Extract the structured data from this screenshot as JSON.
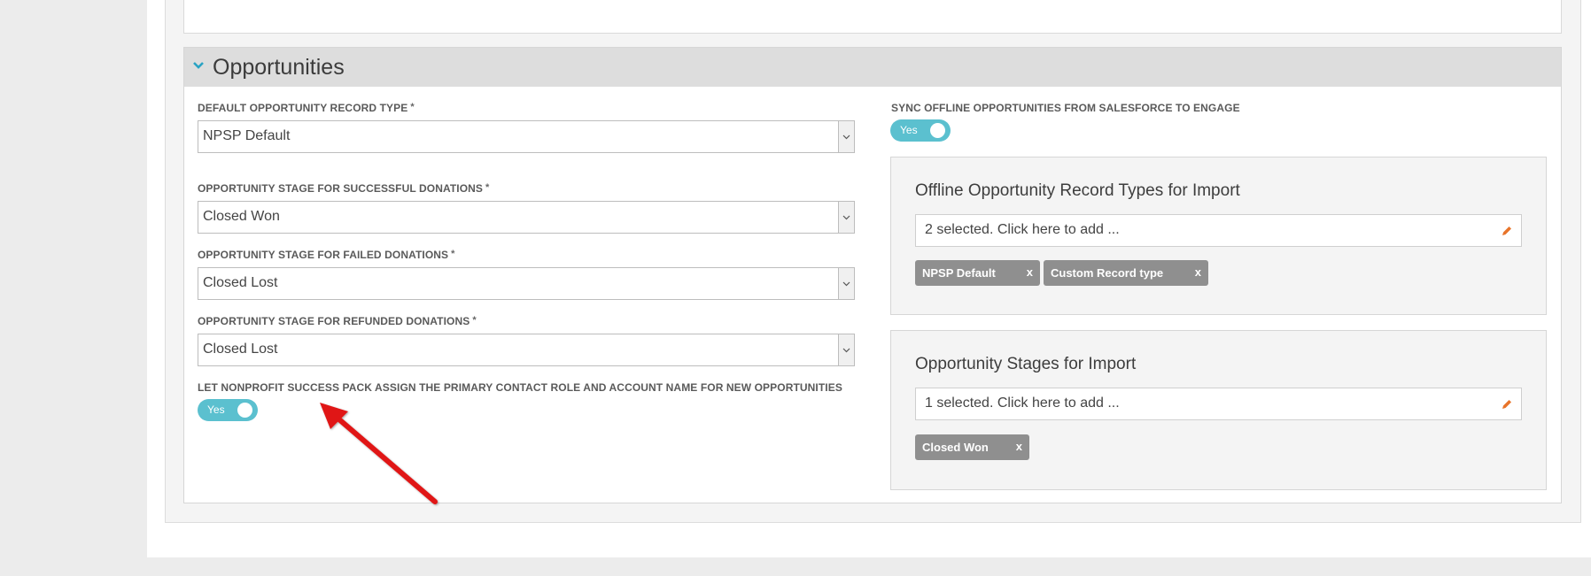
{
  "section": {
    "title": "Opportunities"
  },
  "left": {
    "record_type": {
      "label": "DEFAULT OPPORTUNITY RECORD TYPE",
      "required": "*",
      "value": "NPSP Default"
    },
    "successful": {
      "label": "OPPORTUNITY STAGE FOR SUCCESSFUL DONATIONS",
      "required": "*",
      "value": "Closed Won"
    },
    "failed": {
      "label": "OPPORTUNITY STAGE FOR FAILED DONATIONS",
      "required": "*",
      "value": "Closed Lost"
    },
    "refunded": {
      "label": "OPPORTUNITY STAGE FOR REFUNDED DONATIONS",
      "required": "*",
      "value": "Closed Lost"
    },
    "npsp_assign": {
      "label": "LET NONPROFIT SUCCESS PACK ASSIGN THE PRIMARY CONTACT ROLE AND ACCOUNT NAME FOR NEW OPPORTUNITIES",
      "toggle": "Yes"
    }
  },
  "right": {
    "sync": {
      "label": "SYNC OFFLINE OPPORTUNITIES FROM SALESFORCE TO ENGAGE",
      "toggle": "Yes"
    },
    "record_types_box": {
      "title": "Offline Opportunity Record Types for Import",
      "input": "2 selected. Click here to add ...",
      "chips": [
        "NPSP Default",
        "Custom Record type"
      ]
    },
    "stages_box": {
      "title": "Opportunity Stages for Import",
      "input": "1 selected. Click here to add ...",
      "chips": [
        "Closed Won"
      ]
    },
    "chip_remove": "x"
  },
  "colors": {
    "toggle": "#5bc0cf",
    "chevron": "#2aa3c4",
    "pencil": "#e8742a",
    "chip": "#8f8f8f",
    "arrow": "#e01818"
  }
}
